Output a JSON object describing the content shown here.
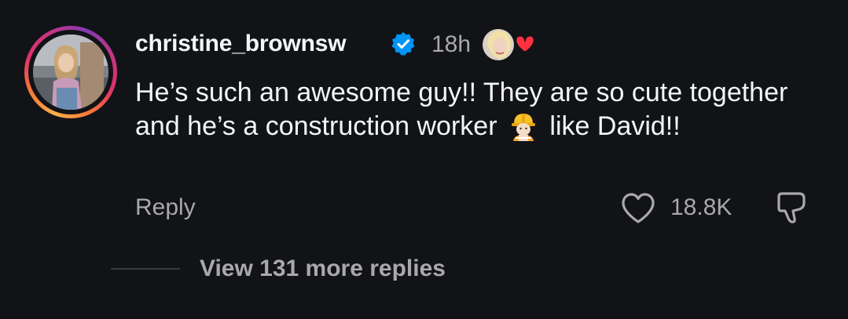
{
  "comment": {
    "username": "christine_brownsw",
    "verified_icon": "verified-badge-icon",
    "time": "18h",
    "liked_by_author_icon": "creator-liked-heart-icon",
    "text_before_emoji": "He’s such an awesome guy!! They are so cute together and he’s a construction worker",
    "emoji": "construction-worker-emoji",
    "text_after_emoji": "like David!!",
    "reply_label": "Reply",
    "like_count": "18.8K",
    "like_icon": "heart-outline-icon",
    "dislike_icon": "thumbs-down-icon"
  },
  "replies": {
    "view_more_label": "View 131 more replies"
  },
  "colors": {
    "background": "#121317",
    "primary_text": "#f3f5f7",
    "secondary_text": "#a8a8ad",
    "verified_blue": "#0095f6",
    "heart_red": "#ff3040"
  }
}
